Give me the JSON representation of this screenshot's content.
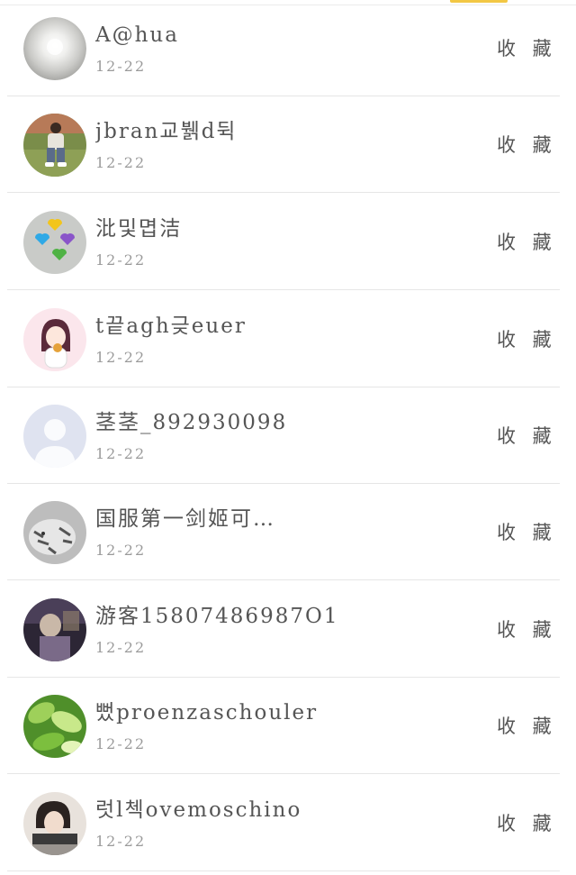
{
  "colors": {
    "top_accent": "#f2c744",
    "name_text": "#555555",
    "date_text": "#9a9a9a",
    "divider": "#e6e6e6"
  },
  "list": {
    "action_label": "收 藏",
    "items": [
      {
        "name": "A@hua",
        "date": "12-22",
        "avatar": "grey-orb-avatar"
      },
      {
        "name": "jbran교뷁d뒥",
        "date": "12-22",
        "avatar": "person-on-grass-avatar"
      },
      {
        "name": "沘및몁洁",
        "date": "12-22",
        "avatar": "colored-hearts-avatar"
      },
      {
        "name": "t끝agh긎euer",
        "date": "12-22",
        "avatar": "cartoon-girl-avatar"
      },
      {
        "name": "茎茎_892930098",
        "date": "12-22",
        "avatar": "default-silhouette-avatar"
      },
      {
        "name": "国服第一剑姬可…",
        "date": "12-22",
        "avatar": "white-tiger-avatar"
      },
      {
        "name": "游客15807486987O1",
        "date": "12-22",
        "avatar": "dark-photo-avatar"
      },
      {
        "name": "뻤proenzaschouler",
        "date": "12-22",
        "avatar": "green-leaves-avatar"
      },
      {
        "name": "럿l첵ovemoschino",
        "date": "12-22",
        "avatar": "person-photo-avatar"
      }
    ]
  }
}
